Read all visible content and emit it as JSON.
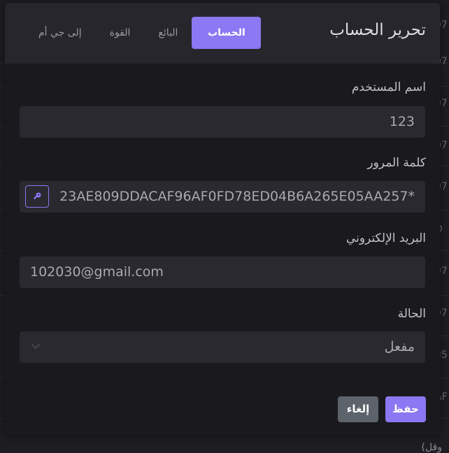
{
  "modal": {
    "title": "تحرير الحساب",
    "tabs": [
      {
        "label": "الحساب",
        "active": true
      },
      {
        "label": "البائع",
        "active": false
      },
      {
        "label": "القوة",
        "active": false
      },
      {
        "label": "إلى جي أم",
        "active": false
      }
    ],
    "fields": {
      "username": {
        "label": "اسم المستخدم",
        "value": "123"
      },
      "password": {
        "label": "كلمة المرور",
        "value": "*23AE809DDACAF96AF0FD78ED04B6A265E05AA257"
      },
      "email": {
        "label": "البريد الإلكتروني",
        "value": "102030@gmail.com"
      },
      "status": {
        "label": "الحالة",
        "value": "مفعل"
      }
    },
    "buttons": {
      "save": "حفظ",
      "cancel": "إلغاء"
    }
  },
  "background": {
    "row_fragments": [
      "07",
      "07",
      "07",
      "07",
      "07",
      "D",
      "07",
      "07",
      "35",
      "AF",
      "07"
    ],
    "bottom_fragment": "(وقل"
  },
  "colors": {
    "accent": "#8c78f2",
    "cancel": "#5c636a",
    "modal_bg": "#1a191e",
    "header_bg": "#27262c",
    "input_bg": "#2a292f"
  },
  "icons": {
    "key": "key-icon",
    "dropdown": "chevron-down-icon"
  }
}
